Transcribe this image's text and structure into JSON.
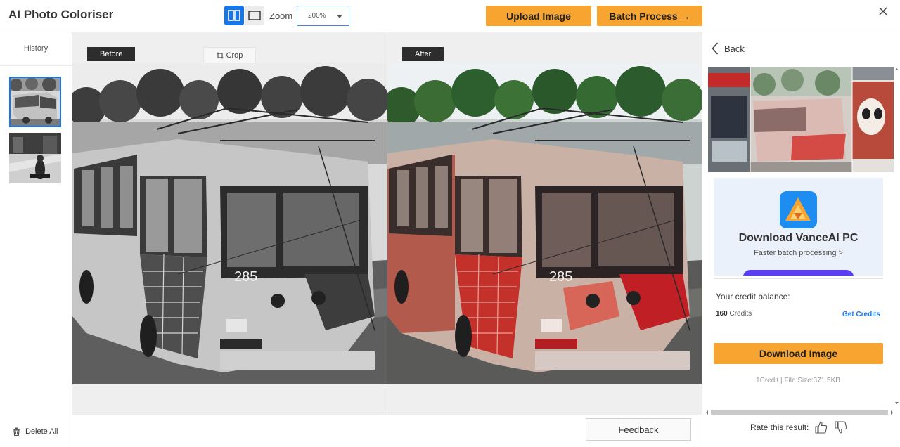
{
  "header": {
    "title": "AI Photo Coloriser",
    "zoom_label": "Zoom",
    "zoom_value": "200%",
    "upload_label": "Upload Image",
    "batch_label": "Batch Process →"
  },
  "history": {
    "title": "History",
    "delete_all": "Delete All"
  },
  "compare": {
    "before_label": "Before",
    "after_label": "After",
    "crop_label": "Crop",
    "plate_number": "285"
  },
  "feedback_label": "Feedback",
  "panel": {
    "back_label": "Back",
    "promo_title": "Download VanceAI PC",
    "promo_sub": "Faster batch processing >",
    "credit_label": "Your credit balance:",
    "credit_value": "160",
    "credit_unit": "Credits",
    "get_credits": "Get Credits",
    "download_label": "Download Image",
    "download_meta": "1Credit | File Size:371.5KB",
    "rate_label": "Rate this result:"
  },
  "colors": {
    "accent_blue": "#1777e8",
    "button_orange": "#f7a431",
    "promo_purple": "#5b3df5"
  },
  "icons": [
    "split-view-icon",
    "single-view-icon",
    "close-icon",
    "crop-icon",
    "trash-icon",
    "chevron-left-icon",
    "thumbs-up-icon",
    "thumbs-down-icon",
    "vanceai-logo-icon"
  ]
}
